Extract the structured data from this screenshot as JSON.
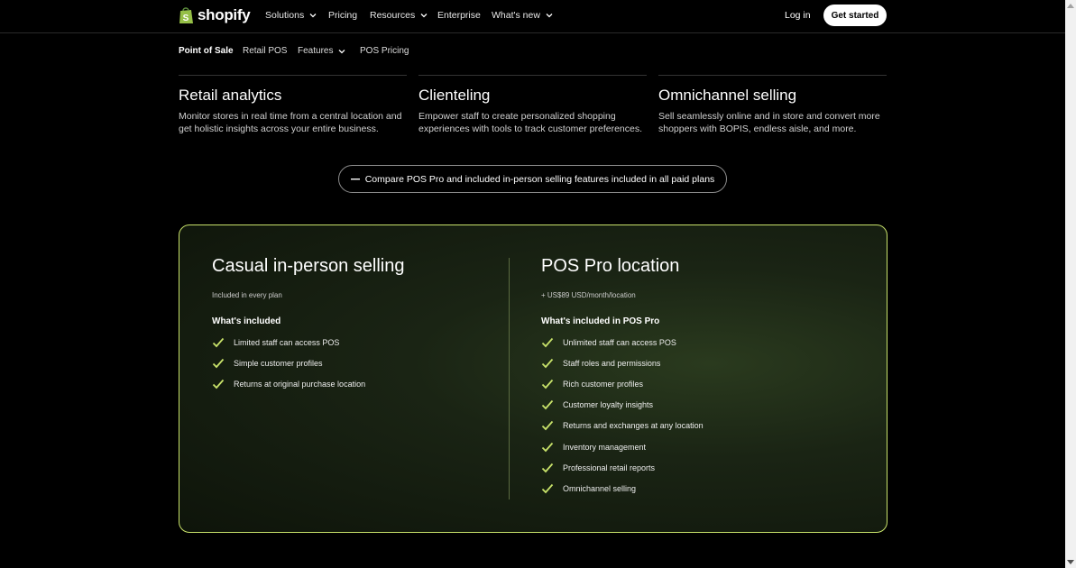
{
  "brand": {
    "name": "shopify",
    "accent": "#c8e26a"
  },
  "topnav": {
    "solutions": "Solutions",
    "pricing": "Pricing",
    "resources": "Resources",
    "enterprise": "Enterprise",
    "whats_new": "What's new",
    "login": "Log in",
    "get_started": "Get started"
  },
  "subnav": {
    "title": "Point of Sale",
    "retail_pos": "Retail POS",
    "features": "Features",
    "pos_pricing": "POS Pricing"
  },
  "features": [
    {
      "title": "Retail analytics",
      "body": "Monitor stores in real time from a central location and get holistic insights across your entire business."
    },
    {
      "title": "Clienteling",
      "body": "Empower staff to create personalized shopping experiences with tools to track customer preferences."
    },
    {
      "title": "Omnichannel selling",
      "body": "Sell seamlessly online and in store and convert more shoppers with BOPIS, endless aisle, and more."
    }
  ],
  "compare_button": "Compare POS Pro and included in-person selling features included in all paid plans",
  "plans": {
    "casual": {
      "title": "Casual in-person selling",
      "subtitle": "Included in every plan",
      "included_label": "What's included",
      "items": [
        "Limited staff can access POS",
        "Simple customer profiles",
        "Returns at original purchase location"
      ]
    },
    "pro": {
      "title": "POS Pro location",
      "subtitle": "+ US$89 USD/month/location",
      "included_label": "What's included in POS Pro",
      "items": [
        "Unlimited staff can access POS",
        "Staff roles and permissions",
        "Rich customer profiles",
        "Customer loyalty insights",
        "Returns and exchanges at any location",
        "Inventory management",
        "Professional retail reports",
        "Omnichannel selling"
      ]
    }
  }
}
